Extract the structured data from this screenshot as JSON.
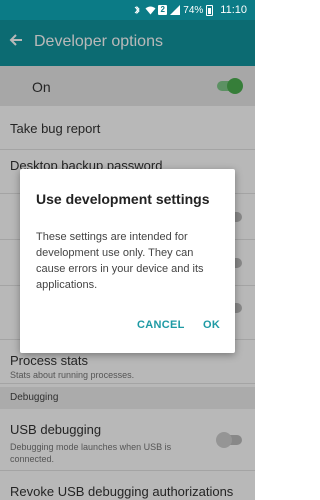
{
  "status_bar": {
    "icons": [
      "bluetooth-icon",
      "wifi-icon",
      "sim-icon",
      "signal-icon",
      "battery-icon"
    ],
    "sim_label": "2",
    "battery": "74%",
    "time": "11:10"
  },
  "appbar": {
    "title": "Developer options"
  },
  "master_toggle": {
    "label": "On",
    "state": "on"
  },
  "settings": {
    "items": [
      {
        "title": "Take bug report",
        "subtitle": ""
      },
      {
        "title": "Desktop backup password",
        "subtitle": ""
      },
      {
        "title": "",
        "subtitle": ""
      },
      {
        "title": "",
        "subtitle": ""
      },
      {
        "title": "",
        "subtitle": ""
      },
      {
        "title": "Process stats",
        "subtitle": "Stats about running processes."
      }
    ],
    "section": "Debugging",
    "usb_debugging": {
      "title": "USB debugging",
      "subtitle": "Debugging mode launches when USB is connected.",
      "state": "off"
    },
    "revoke": {
      "title": "Revoke USB debugging authorizations"
    }
  },
  "dialog": {
    "title": "Use development settings",
    "message": "These settings are intended for development use only. They can cause errors in your device and its applications.",
    "cancel_label": "CANCEL",
    "ok_label": "OK"
  },
  "colors": {
    "status_bar": "#0b7b86",
    "appbar": "#11959f",
    "toggle_on": "#4caf50",
    "dialog_button": "#1e9aa4"
  }
}
